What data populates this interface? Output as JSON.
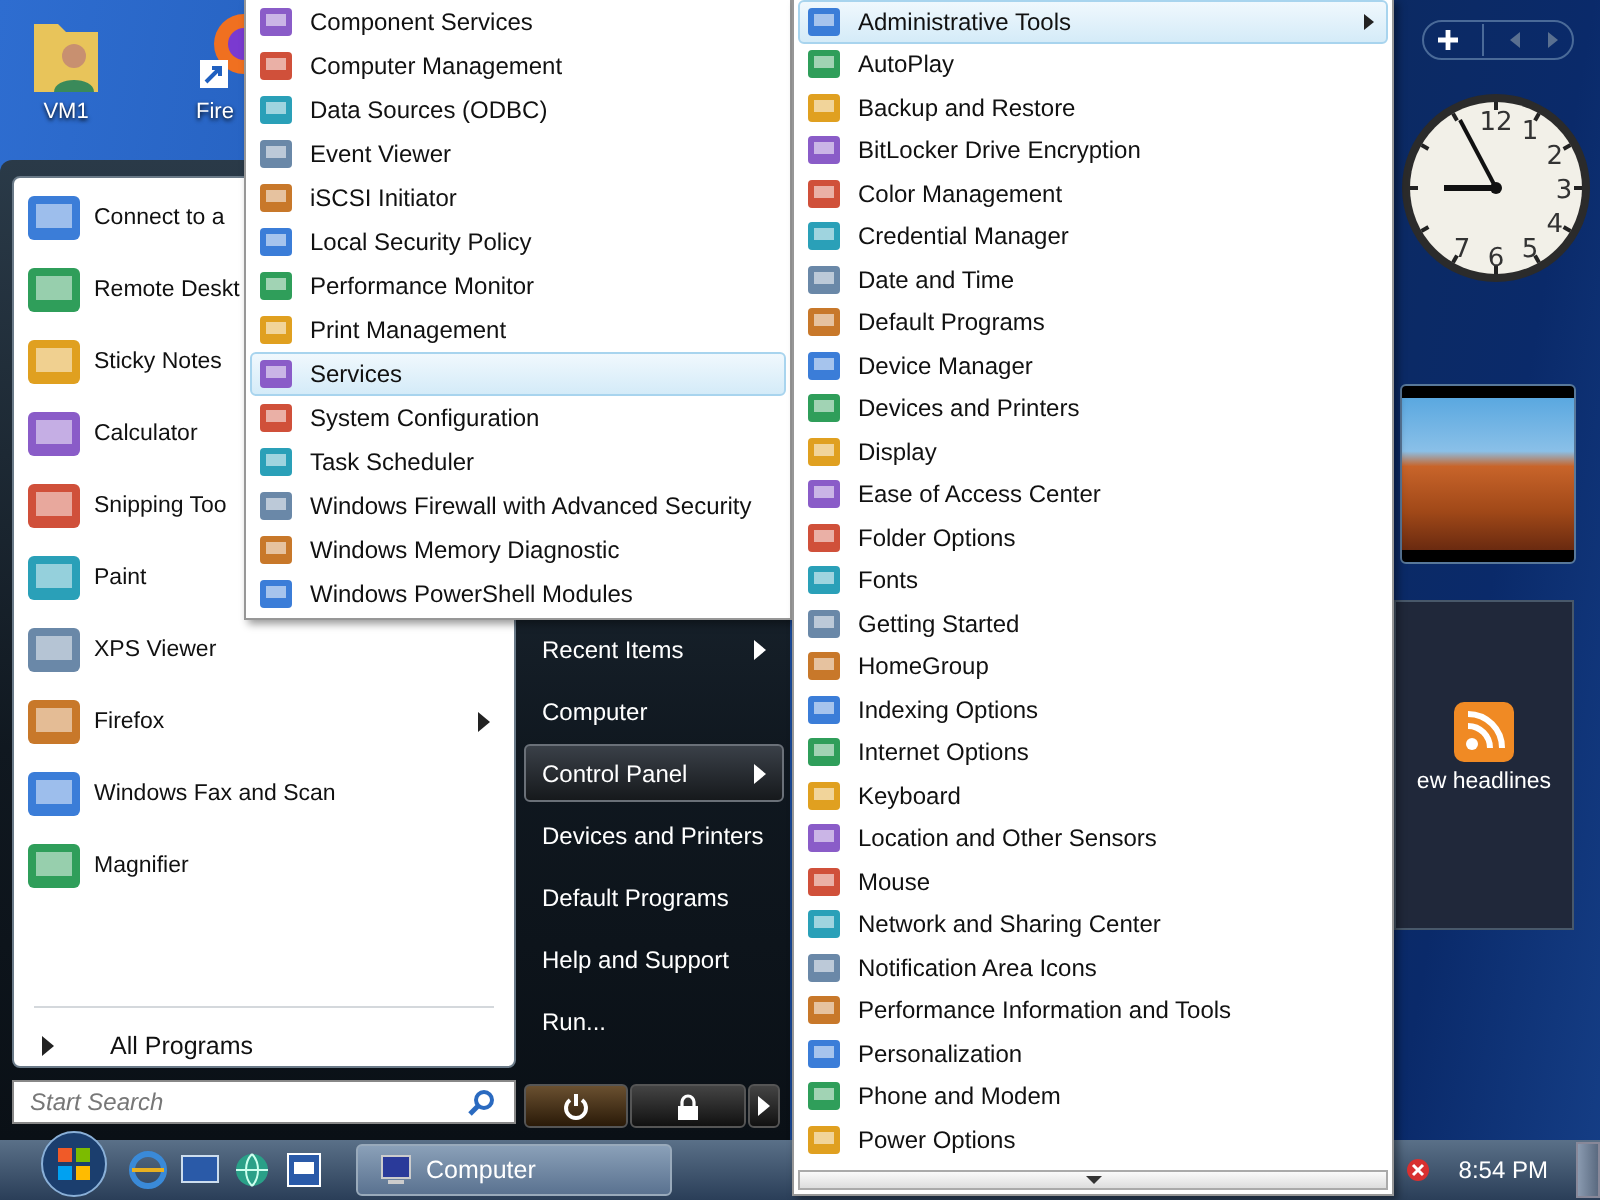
{
  "desktop_icons": [
    {
      "label": "VM1",
      "kind": "folder"
    },
    {
      "label": "Fire",
      "kind": "browser"
    }
  ],
  "start_menu": {
    "programs": [
      {
        "label": "Connect to a",
        "submenu": false
      },
      {
        "label": "Remote Deskt",
        "submenu": false
      },
      {
        "label": "Sticky Notes",
        "submenu": false
      },
      {
        "label": "Calculator",
        "submenu": false
      },
      {
        "label": "Snipping Too",
        "submenu": false
      },
      {
        "label": "Paint",
        "submenu": false
      },
      {
        "label": "XPS Viewer",
        "submenu": false
      },
      {
        "label": "Firefox",
        "submenu": true
      },
      {
        "label": "Windows Fax and Scan",
        "submenu": false
      },
      {
        "label": "Magnifier",
        "submenu": false
      }
    ],
    "all_programs": "All Programs",
    "search": {
      "placeholder": "Start Search"
    },
    "places": [
      {
        "label": "Recent Items",
        "selected": false,
        "submenu": true
      },
      {
        "label": "Computer",
        "selected": false,
        "submenu": false
      },
      {
        "label": "Control Panel",
        "selected": true,
        "submenu": true
      },
      {
        "label": "Devices and Printers",
        "selected": false,
        "submenu": false
      },
      {
        "label": "Default Programs",
        "selected": false,
        "submenu": false
      },
      {
        "label": "Help and Support",
        "selected": false,
        "submenu": false
      },
      {
        "label": "Run...",
        "selected": false,
        "submenu": false
      }
    ]
  },
  "admin_tools": {
    "items": [
      {
        "label": "Component Services",
        "selected": false
      },
      {
        "label": "Computer Management",
        "selected": false
      },
      {
        "label": "Data Sources (ODBC)",
        "selected": false
      },
      {
        "label": "Event Viewer",
        "selected": false
      },
      {
        "label": "iSCSI Initiator",
        "selected": false
      },
      {
        "label": "Local Security Policy",
        "selected": false
      },
      {
        "label": "Performance Monitor",
        "selected": false
      },
      {
        "label": "Print Management",
        "selected": false
      },
      {
        "label": "Services",
        "selected": true
      },
      {
        "label": "System Configuration",
        "selected": false
      },
      {
        "label": "Task Scheduler",
        "selected": false
      },
      {
        "label": "Windows Firewall with Advanced Security",
        "selected": false
      },
      {
        "label": "Windows Memory Diagnostic",
        "selected": false
      },
      {
        "label": "Windows PowerShell Modules",
        "selected": false
      }
    ]
  },
  "control_panel": {
    "items": [
      {
        "label": "Administrative Tools",
        "selected": true,
        "submenu": true
      },
      {
        "label": "AutoPlay",
        "selected": false,
        "submenu": false
      },
      {
        "label": "Backup and Restore",
        "selected": false,
        "submenu": false
      },
      {
        "label": "BitLocker Drive Encryption",
        "selected": false,
        "submenu": false
      },
      {
        "label": "Color Management",
        "selected": false,
        "submenu": false
      },
      {
        "label": "Credential Manager",
        "selected": false,
        "submenu": false
      },
      {
        "label": "Date and Time",
        "selected": false,
        "submenu": false
      },
      {
        "label": "Default Programs",
        "selected": false,
        "submenu": false
      },
      {
        "label": "Device Manager",
        "selected": false,
        "submenu": false
      },
      {
        "label": "Devices and Printers",
        "selected": false,
        "submenu": false
      },
      {
        "label": "Display",
        "selected": false,
        "submenu": false
      },
      {
        "label": "Ease of Access Center",
        "selected": false,
        "submenu": false
      },
      {
        "label": "Folder Options",
        "selected": false,
        "submenu": false
      },
      {
        "label": "Fonts",
        "selected": false,
        "submenu": false
      },
      {
        "label": "Getting Started",
        "selected": false,
        "submenu": false
      },
      {
        "label": "HomeGroup",
        "selected": false,
        "submenu": false
      },
      {
        "label": "Indexing Options",
        "selected": false,
        "submenu": false
      },
      {
        "label": "Internet Options",
        "selected": false,
        "submenu": false
      },
      {
        "label": "Keyboard",
        "selected": false,
        "submenu": false
      },
      {
        "label": "Location and Other Sensors",
        "selected": false,
        "submenu": false
      },
      {
        "label": "Mouse",
        "selected": false,
        "submenu": false
      },
      {
        "label": "Network and Sharing Center",
        "selected": false,
        "submenu": false
      },
      {
        "label": "Notification Area Icons",
        "selected": false,
        "submenu": false
      },
      {
        "label": "Performance Information and Tools",
        "selected": false,
        "submenu": false
      },
      {
        "label": "Personalization",
        "selected": false,
        "submenu": false
      },
      {
        "label": "Phone and Modem",
        "selected": false,
        "submenu": false
      },
      {
        "label": "Power Options",
        "selected": false,
        "submenu": false
      }
    ]
  },
  "gadgets": {
    "clock_numerals": [
      "12",
      "1",
      "2",
      "3",
      "4",
      "5",
      "6",
      "7"
    ],
    "feed_text": "ew headlines"
  },
  "taskbar": {
    "tasks": [
      {
        "label": "Computer"
      }
    ],
    "time": "8:54 PM"
  }
}
